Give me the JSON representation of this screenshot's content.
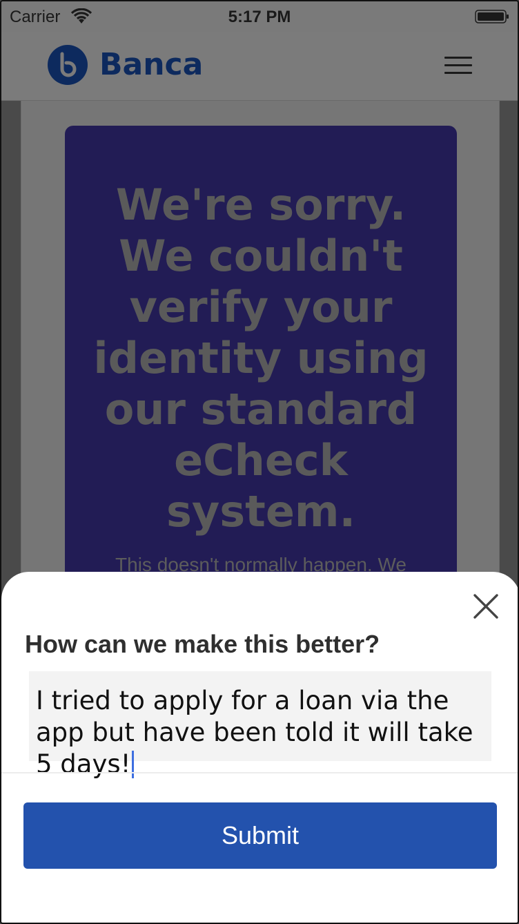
{
  "status_bar": {
    "carrier": "Carrier",
    "time": "5:17 PM"
  },
  "header": {
    "brand_name": "Banca",
    "logo_icon": "banca-logo",
    "menu_icon": "hamburger-menu-icon"
  },
  "hero": {
    "title": "We're sorry. We couldn't verify your identity using our standard eCheck system.",
    "subtitle": "This doesn't normally happen. We"
  },
  "feedback_sheet": {
    "heading": "How can we make this better?",
    "input_value": "I tried to apply for a loan via the app but have been told it will take 5 days!",
    "submit_label": "Submit",
    "close_icon": "close-icon"
  },
  "colors": {
    "hero_background": "#221c55",
    "submit_button": "#2352ad",
    "brand_text": "#0d2a5e",
    "caret": "#3d6ee0"
  }
}
